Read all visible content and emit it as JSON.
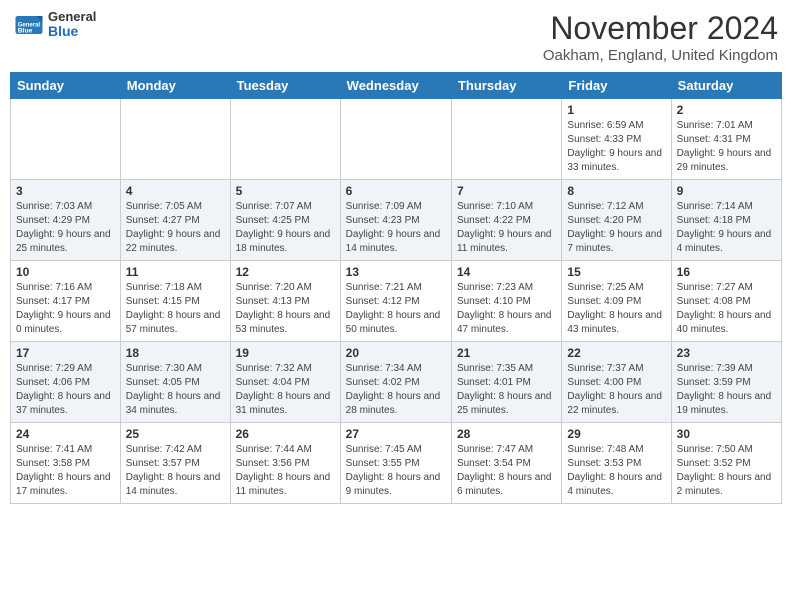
{
  "header": {
    "logo_general": "General",
    "logo_blue": "Blue",
    "month_title": "November 2024",
    "location": "Oakham, England, United Kingdom"
  },
  "days_of_week": [
    "Sunday",
    "Monday",
    "Tuesday",
    "Wednesday",
    "Thursday",
    "Friday",
    "Saturday"
  ],
  "weeks": [
    [
      {
        "day": "",
        "info": ""
      },
      {
        "day": "",
        "info": ""
      },
      {
        "day": "",
        "info": ""
      },
      {
        "day": "",
        "info": ""
      },
      {
        "day": "",
        "info": ""
      },
      {
        "day": "1",
        "info": "Sunrise: 6:59 AM\nSunset: 4:33 PM\nDaylight: 9 hours and 33 minutes."
      },
      {
        "day": "2",
        "info": "Sunrise: 7:01 AM\nSunset: 4:31 PM\nDaylight: 9 hours and 29 minutes."
      }
    ],
    [
      {
        "day": "3",
        "info": "Sunrise: 7:03 AM\nSunset: 4:29 PM\nDaylight: 9 hours and 25 minutes."
      },
      {
        "day": "4",
        "info": "Sunrise: 7:05 AM\nSunset: 4:27 PM\nDaylight: 9 hours and 22 minutes."
      },
      {
        "day": "5",
        "info": "Sunrise: 7:07 AM\nSunset: 4:25 PM\nDaylight: 9 hours and 18 minutes."
      },
      {
        "day": "6",
        "info": "Sunrise: 7:09 AM\nSunset: 4:23 PM\nDaylight: 9 hours and 14 minutes."
      },
      {
        "day": "7",
        "info": "Sunrise: 7:10 AM\nSunset: 4:22 PM\nDaylight: 9 hours and 11 minutes."
      },
      {
        "day": "8",
        "info": "Sunrise: 7:12 AM\nSunset: 4:20 PM\nDaylight: 9 hours and 7 minutes."
      },
      {
        "day": "9",
        "info": "Sunrise: 7:14 AM\nSunset: 4:18 PM\nDaylight: 9 hours and 4 minutes."
      }
    ],
    [
      {
        "day": "10",
        "info": "Sunrise: 7:16 AM\nSunset: 4:17 PM\nDaylight: 9 hours and 0 minutes."
      },
      {
        "day": "11",
        "info": "Sunrise: 7:18 AM\nSunset: 4:15 PM\nDaylight: 8 hours and 57 minutes."
      },
      {
        "day": "12",
        "info": "Sunrise: 7:20 AM\nSunset: 4:13 PM\nDaylight: 8 hours and 53 minutes."
      },
      {
        "day": "13",
        "info": "Sunrise: 7:21 AM\nSunset: 4:12 PM\nDaylight: 8 hours and 50 minutes."
      },
      {
        "day": "14",
        "info": "Sunrise: 7:23 AM\nSunset: 4:10 PM\nDaylight: 8 hours and 47 minutes."
      },
      {
        "day": "15",
        "info": "Sunrise: 7:25 AM\nSunset: 4:09 PM\nDaylight: 8 hours and 43 minutes."
      },
      {
        "day": "16",
        "info": "Sunrise: 7:27 AM\nSunset: 4:08 PM\nDaylight: 8 hours and 40 minutes."
      }
    ],
    [
      {
        "day": "17",
        "info": "Sunrise: 7:29 AM\nSunset: 4:06 PM\nDaylight: 8 hours and 37 minutes."
      },
      {
        "day": "18",
        "info": "Sunrise: 7:30 AM\nSunset: 4:05 PM\nDaylight: 8 hours and 34 minutes."
      },
      {
        "day": "19",
        "info": "Sunrise: 7:32 AM\nSunset: 4:04 PM\nDaylight: 8 hours and 31 minutes."
      },
      {
        "day": "20",
        "info": "Sunrise: 7:34 AM\nSunset: 4:02 PM\nDaylight: 8 hours and 28 minutes."
      },
      {
        "day": "21",
        "info": "Sunrise: 7:35 AM\nSunset: 4:01 PM\nDaylight: 8 hours and 25 minutes."
      },
      {
        "day": "22",
        "info": "Sunrise: 7:37 AM\nSunset: 4:00 PM\nDaylight: 8 hours and 22 minutes."
      },
      {
        "day": "23",
        "info": "Sunrise: 7:39 AM\nSunset: 3:59 PM\nDaylight: 8 hours and 19 minutes."
      }
    ],
    [
      {
        "day": "24",
        "info": "Sunrise: 7:41 AM\nSunset: 3:58 PM\nDaylight: 8 hours and 17 minutes."
      },
      {
        "day": "25",
        "info": "Sunrise: 7:42 AM\nSunset: 3:57 PM\nDaylight: 8 hours and 14 minutes."
      },
      {
        "day": "26",
        "info": "Sunrise: 7:44 AM\nSunset: 3:56 PM\nDaylight: 8 hours and 11 minutes."
      },
      {
        "day": "27",
        "info": "Sunrise: 7:45 AM\nSunset: 3:55 PM\nDaylight: 8 hours and 9 minutes."
      },
      {
        "day": "28",
        "info": "Sunrise: 7:47 AM\nSunset: 3:54 PM\nDaylight: 8 hours and 6 minutes."
      },
      {
        "day": "29",
        "info": "Sunrise: 7:48 AM\nSunset: 3:53 PM\nDaylight: 8 hours and 4 minutes."
      },
      {
        "day": "30",
        "info": "Sunrise: 7:50 AM\nSunset: 3:52 PM\nDaylight: 8 hours and 2 minutes."
      }
    ]
  ]
}
